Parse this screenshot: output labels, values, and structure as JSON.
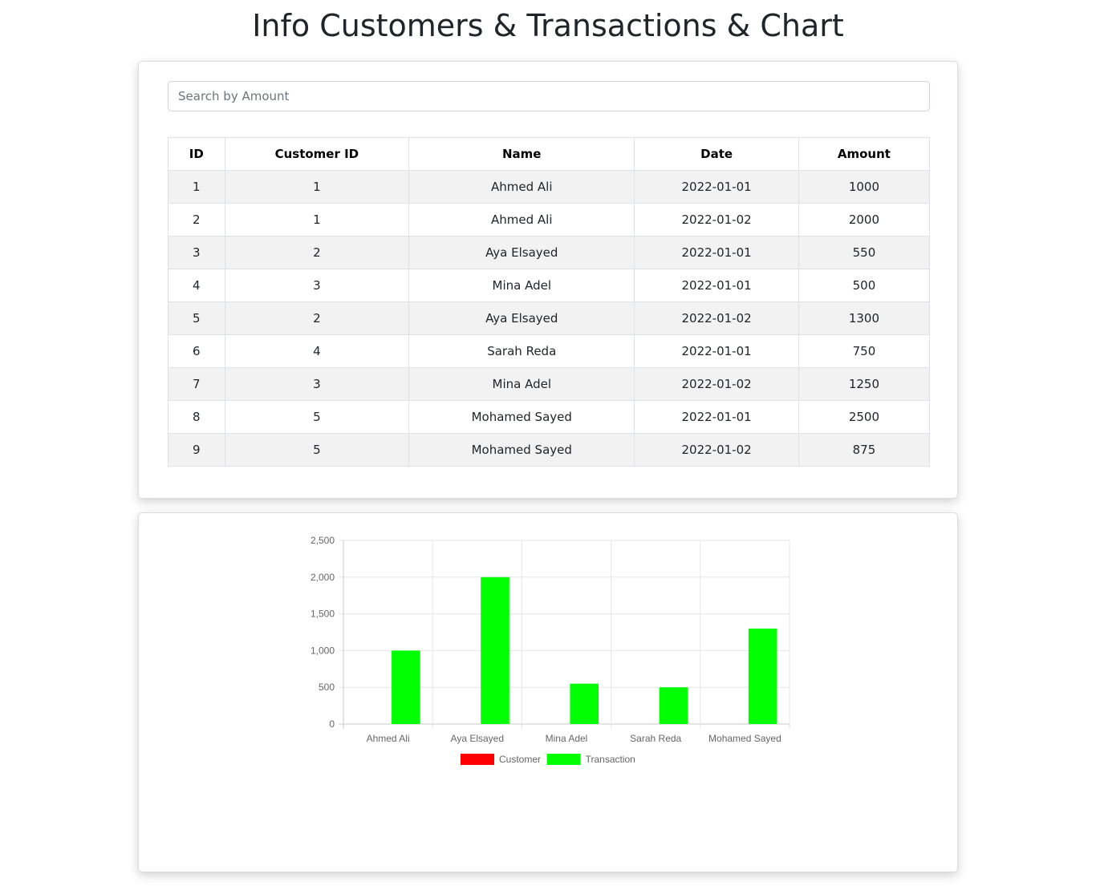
{
  "page": {
    "title": "Info Customers & Transactions & Chart"
  },
  "search": {
    "placeholder": "Search by Amount",
    "value": ""
  },
  "table": {
    "columns": [
      "ID",
      "Customer ID",
      "Name",
      "Date",
      "Amount"
    ],
    "rows": [
      [
        "1",
        "1",
        "Ahmed Ali",
        "2022-01-01",
        "1000"
      ],
      [
        "2",
        "1",
        "Ahmed Ali",
        "2022-01-02",
        "2000"
      ],
      [
        "3",
        "2",
        "Aya Elsayed",
        "2022-01-01",
        "550"
      ],
      [
        "4",
        "3",
        "Mina Adel",
        "2022-01-01",
        "500"
      ],
      [
        "5",
        "2",
        "Aya Elsayed",
        "2022-01-02",
        "1300"
      ],
      [
        "6",
        "4",
        "Sarah Reda",
        "2022-01-01",
        "750"
      ],
      [
        "7",
        "3",
        "Mina Adel",
        "2022-01-02",
        "1250"
      ],
      [
        "8",
        "5",
        "Mohamed Sayed",
        "2022-01-01",
        "2500"
      ],
      [
        "9",
        "5",
        "Mohamed Sayed",
        "2022-01-02",
        "875"
      ]
    ]
  },
  "chart_data": {
    "type": "bar",
    "categories": [
      "Ahmed Ali",
      "Aya Elsayed",
      "Mina Adel",
      "Sarah Reda",
      "Mohamed Sayed"
    ],
    "series": [
      {
        "name": "Customer",
        "color": "#ff0000",
        "values": [
          0,
          0,
          0,
          0,
          0
        ]
      },
      {
        "name": "Transaction",
        "color": "#00ff00",
        "values": [
          1000,
          2000,
          550,
          500,
          1300
        ]
      }
    ],
    "yticks": [
      "0",
      "500",
      "1,000",
      "1,500",
      "2,000",
      "2,500"
    ],
    "ylim": [
      0,
      2500
    ],
    "grid": true,
    "legend_position": "bottom"
  }
}
